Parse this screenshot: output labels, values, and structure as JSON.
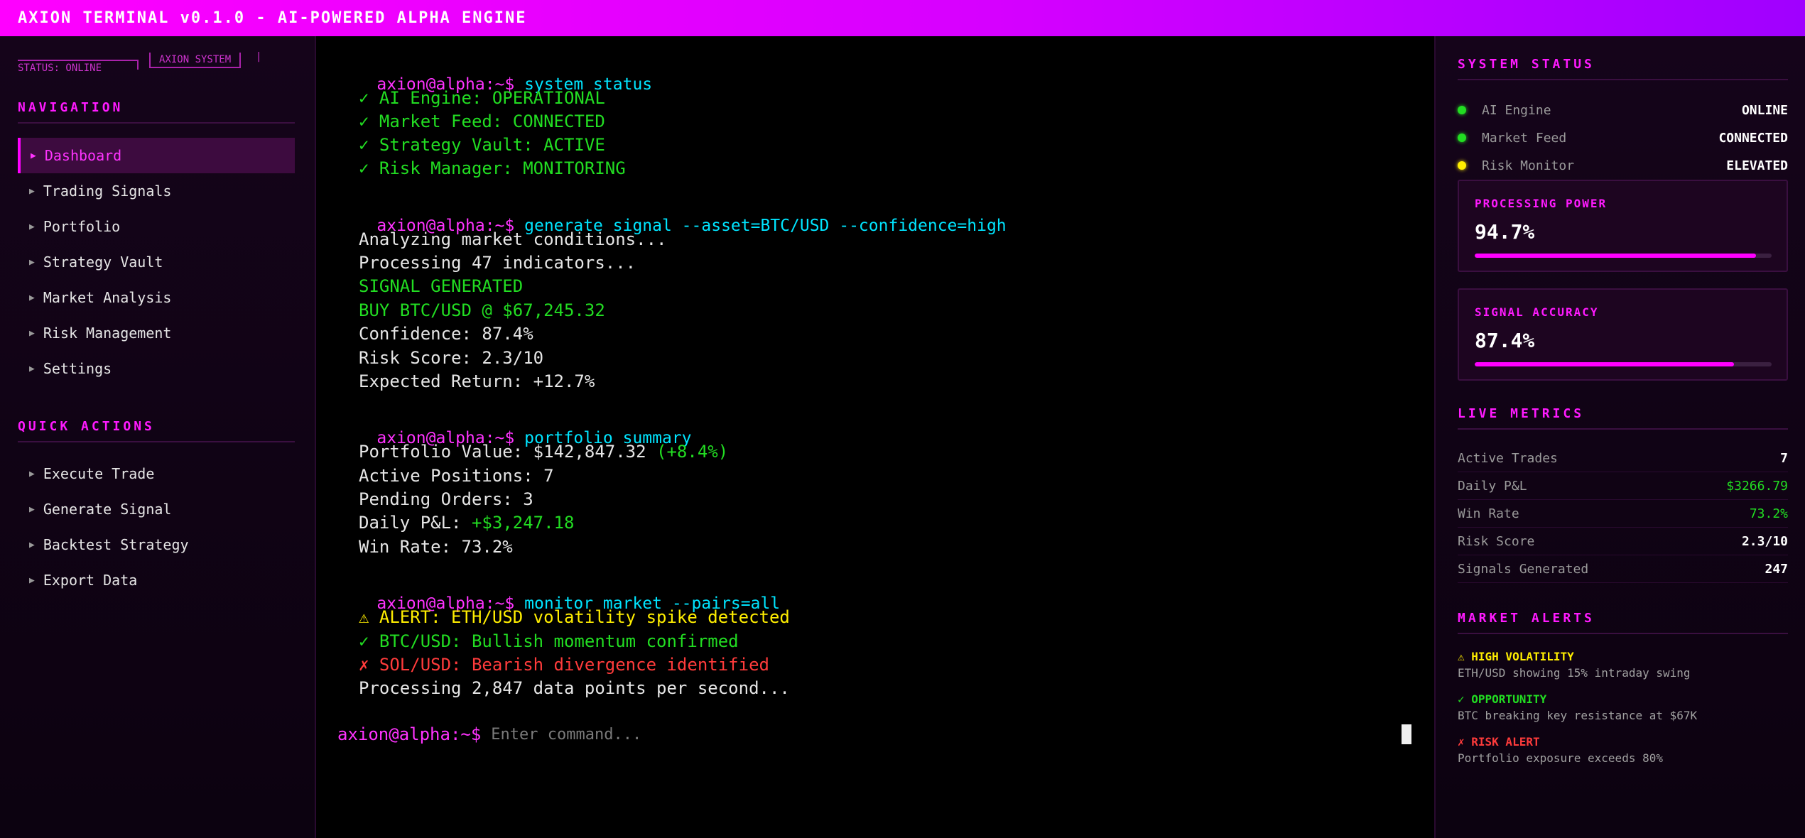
{
  "app": {
    "title": "AXION TERMINAL v0.1.0 - AI-POWERED ALPHA ENGINE"
  },
  "sidebar": {
    "banner_system": "AXION SYSTEM",
    "banner_status": "STATUS: ONLINE",
    "nav_title": "NAVIGATION",
    "nav_items": [
      {
        "label": "Dashboard",
        "active": true
      },
      {
        "label": "Trading Signals"
      },
      {
        "label": "Portfolio"
      },
      {
        "label": "Strategy Vault"
      },
      {
        "label": "Market Analysis"
      },
      {
        "label": "Risk Management"
      },
      {
        "label": "Settings"
      }
    ],
    "quick_title": "QUICK ACTIONS",
    "quick_items": [
      {
        "label": "Execute Trade"
      },
      {
        "label": "Generate Signal"
      },
      {
        "label": "Backtest Strategy"
      },
      {
        "label": "Export Data"
      }
    ]
  },
  "terminal": {
    "prompt": "axion@alpha:~$",
    "blocks": [
      {
        "command": "system status",
        "lines": [
          {
            "text": "✓ AI Engine: OPERATIONAL",
            "color": "green"
          },
          {
            "text": "✓ Market Feed: CONNECTED",
            "color": "green"
          },
          {
            "text": "✓ Strategy Vault: ACTIVE",
            "color": "green"
          },
          {
            "text": "✓ Risk Manager: MONITORING",
            "color": "green"
          }
        ]
      },
      {
        "command": "generate signal --asset=BTC/USD --confidence=high",
        "lines": [
          {
            "text": "Analyzing market conditions...",
            "color": "white"
          },
          {
            "text": "Processing 47 indicators...",
            "color": "white"
          },
          {
            "text": "SIGNAL GENERATED",
            "color": "green"
          },
          {
            "text": "BUY BTC/USD @ $67,245.32",
            "color": "green"
          },
          {
            "text": "Confidence: 87.4%",
            "color": "white"
          },
          {
            "text": "Risk Score: 2.3/10",
            "color": "white"
          },
          {
            "text": "Expected Return: +12.7%",
            "color": "white"
          }
        ]
      },
      {
        "command": "portfolio summary",
        "lines": [
          {
            "text": "Portfolio Value: $142,847.32 ",
            "color": "white",
            "suffix": "(+8.4%)",
            "suffix_color": "green"
          },
          {
            "text": "Active Positions: 7",
            "color": "white"
          },
          {
            "text": "Pending Orders: 3",
            "color": "white"
          },
          {
            "text": "Daily P&L: ",
            "color": "white",
            "suffix": "+$3,247.18",
            "suffix_color": "green"
          },
          {
            "text": "Win Rate: 73.2%",
            "color": "white"
          }
        ]
      },
      {
        "command": "monitor market --pairs=all",
        "lines": [
          {
            "text": "⚠ ALERT: ETH/USD volatility spike detected",
            "color": "yellow"
          },
          {
            "text": "✓ BTC/USD: Bullish momentum confirmed",
            "color": "green"
          },
          {
            "text": "✗ SOL/USD: Bearish divergence identified",
            "color": "red"
          },
          {
            "text": "Processing 2,847 data points per second...",
            "color": "white"
          }
        ]
      }
    ],
    "input_placeholder": "Enter command..."
  },
  "right": {
    "status_title": "SYSTEM STATUS",
    "status": [
      {
        "label": "AI Engine",
        "value": "ONLINE",
        "dot": "#22dd22"
      },
      {
        "label": "Market Feed",
        "value": "CONNECTED",
        "dot": "#22dd22"
      },
      {
        "label": "Risk Monitor",
        "value": "ELEVATED",
        "dot": "#ffee00"
      }
    ],
    "cards": [
      {
        "label": "PROCESSING POWER",
        "value": "94.7%",
        "fill": 0.947
      },
      {
        "label": "SIGNAL ACCURACY",
        "value": "87.4%",
        "fill": 0.874
      }
    ],
    "metrics_title": "LIVE METRICS",
    "metrics": [
      {
        "label": "Active Trades",
        "value": "7"
      },
      {
        "label": "Daily P&L",
        "value": "$3266.79",
        "color": "green"
      },
      {
        "label": "Win Rate",
        "value": "73.2%",
        "color": "green"
      },
      {
        "label": "Risk Score",
        "value": "2.3/10"
      },
      {
        "label": "Signals Generated",
        "value": "247"
      }
    ],
    "alerts_title": "MARKET ALERTS",
    "alerts": [
      {
        "title": "⚠ HIGH VOLATILITY",
        "desc": "ETH/USD showing 15% intraday swing",
        "color": "#ffee00"
      },
      {
        "title": "✓ OPPORTUNITY",
        "desc": "BTC breaking key resistance at $67K",
        "color": "#22dd22"
      },
      {
        "title": "✗ RISK ALERT",
        "desc": "Portfolio exposure exceeds 80%",
        "color": "#ff3b3b"
      }
    ]
  }
}
